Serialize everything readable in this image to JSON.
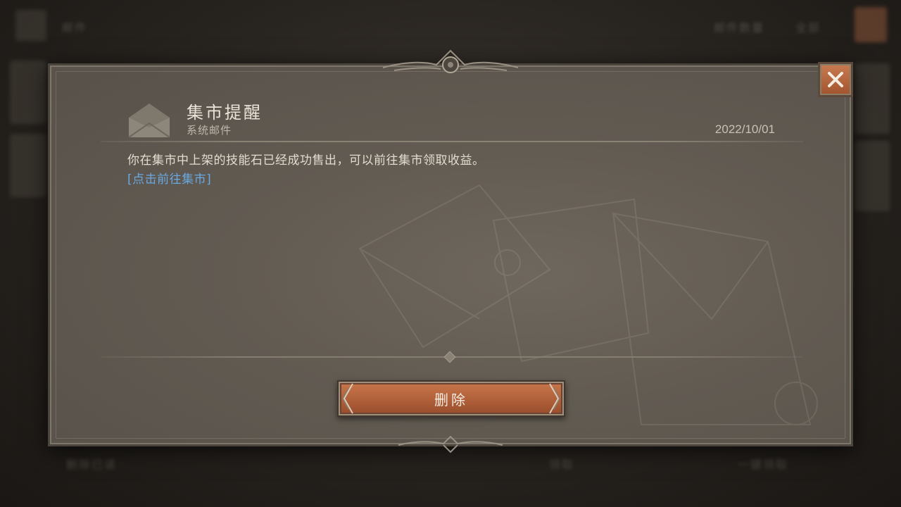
{
  "background": {
    "header_left": "邮件",
    "header_right_1": "邮件数量",
    "header_right_2": "全部",
    "footer_left": "删除已读",
    "footer_mid": "领取",
    "footer_right": "一键领取"
  },
  "mail": {
    "icon": "envelope-icon",
    "title": "集市提醒",
    "category": "系统邮件",
    "date": "2022/10/01",
    "body": "你在集市中上架的技能石已经成功售出，可以前往集市领取收益。",
    "link": "[点击前往集市]"
  },
  "actions": {
    "delete_label": "删除",
    "close_icon": "close-icon"
  },
  "colors": {
    "accent": "#b5633c",
    "link": "#6aa8e0",
    "panel": "#625b52"
  }
}
